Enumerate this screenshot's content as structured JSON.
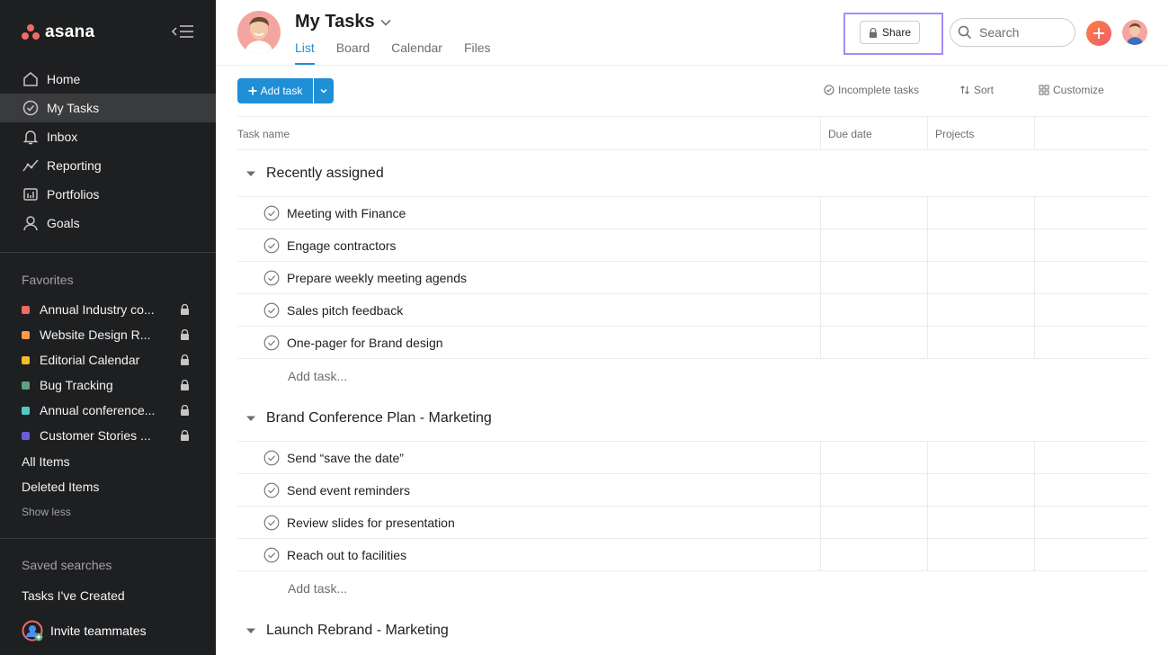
{
  "app": {
    "name": "asana"
  },
  "sidebar": {
    "nav": [
      {
        "label": "Home",
        "icon": "home-icon"
      },
      {
        "label": "My Tasks",
        "icon": "check-circle-icon",
        "active": true
      },
      {
        "label": "Inbox",
        "icon": "bell-icon"
      },
      {
        "label": "Reporting",
        "icon": "line-graph-icon"
      },
      {
        "label": "Portfolios",
        "icon": "portfolio-icon"
      },
      {
        "label": "Goals",
        "icon": "person-icon"
      }
    ],
    "favorites_title": "Favorites",
    "favorites": [
      {
        "label": "Annual Industry co...",
        "color": "#f06a6a"
      },
      {
        "label": "Website Design R...",
        "color": "#fd9a4d"
      },
      {
        "label": "Editorial Calendar",
        "color": "#f1bd2c"
      },
      {
        "label": "Bug Tracking",
        "color": "#5da283"
      },
      {
        "label": "Annual conference...",
        "color": "#4ecbc4"
      },
      {
        "label": "Customer Stories ...",
        "color": "#6c5cdb"
      }
    ],
    "all_items": "All Items",
    "deleted_items": "Deleted Items",
    "show_less": "Show less",
    "saved_searches_title": "Saved searches",
    "saved_searches": [
      "Tasks I've Created"
    ],
    "invite": "Invite teammates"
  },
  "header": {
    "title": "My Tasks",
    "tabs": [
      {
        "label": "List",
        "active": true
      },
      {
        "label": "Board"
      },
      {
        "label": "Calendar"
      },
      {
        "label": "Files"
      }
    ],
    "share_label": "Share",
    "search_placeholder": "Search"
  },
  "toolbar": {
    "add_task_label": "Add task",
    "incomplete_label": "Incomplete tasks",
    "sort_label": "Sort",
    "customize_label": "Customize"
  },
  "table": {
    "columns": [
      "Task name",
      "Due date",
      "Projects"
    ],
    "add_task_placeholder": "Add task...",
    "sections": [
      {
        "name": "Recently assigned",
        "tasks": [
          "Meeting with Finance",
          "Engage contractors",
          "Prepare weekly meeting agends",
          "Sales pitch feedback",
          "One-pager for Brand design"
        ]
      },
      {
        "name": "Brand Conference Plan - Marketing",
        "tasks": [
          "Send “save the date”",
          "Send event reminders",
          "Review slides for presentation",
          "Reach out to facilities"
        ]
      },
      {
        "name": "Launch Rebrand - Marketing",
        "tasks": []
      }
    ]
  },
  "colors": {
    "sidebar_bg": "#1e1f21",
    "accent_blue": "#1f8fd6",
    "brand_coral": "#f06a6a",
    "highlight_purple": "#a78bf4"
  }
}
